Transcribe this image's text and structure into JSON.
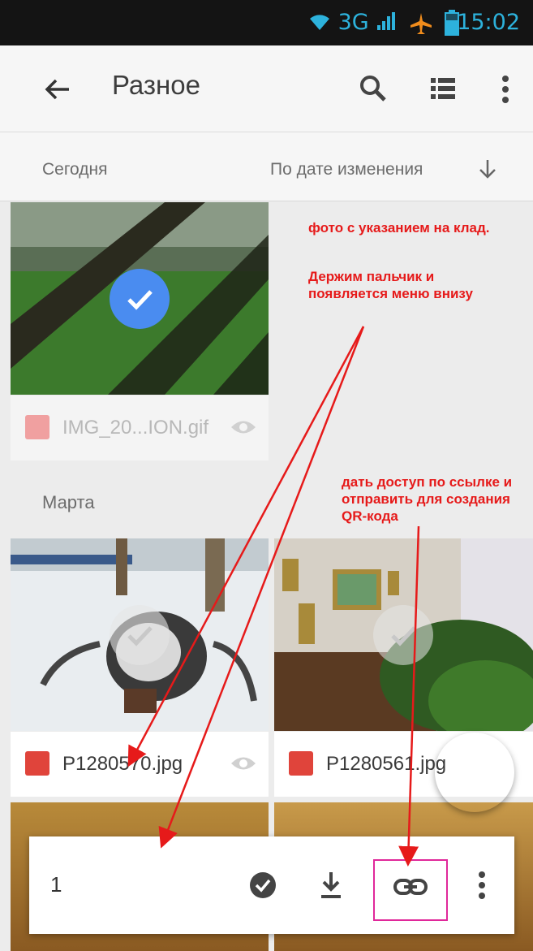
{
  "status_bar": {
    "network": "3G",
    "time": "15:02"
  },
  "app_bar": {
    "title": "Разное"
  },
  "sort_bar": {
    "section_today": "Сегодня",
    "sort_label": "По дате изменения"
  },
  "files_today": [
    {
      "name": "IMG_20...ION.gif"
    }
  ],
  "section_march": "Марта",
  "files_march": [
    {
      "name": "P1280570.jpg"
    },
    {
      "name": "P1280561.jpg"
    }
  ],
  "annotations": {
    "note_top": "фото с указанием на клад.",
    "note_hold": "Держим пальчик и появляется меню внизу",
    "note_link": "дать доступ по ссылке и отправить для создания QR-кода"
  },
  "action_bar": {
    "selected_count": "1"
  },
  "colors": {
    "accent_blue": "#3b82f0",
    "annotation_red": "#e61a1a",
    "highlight_magenta": "#e0289a",
    "status_bg": "#141414"
  }
}
